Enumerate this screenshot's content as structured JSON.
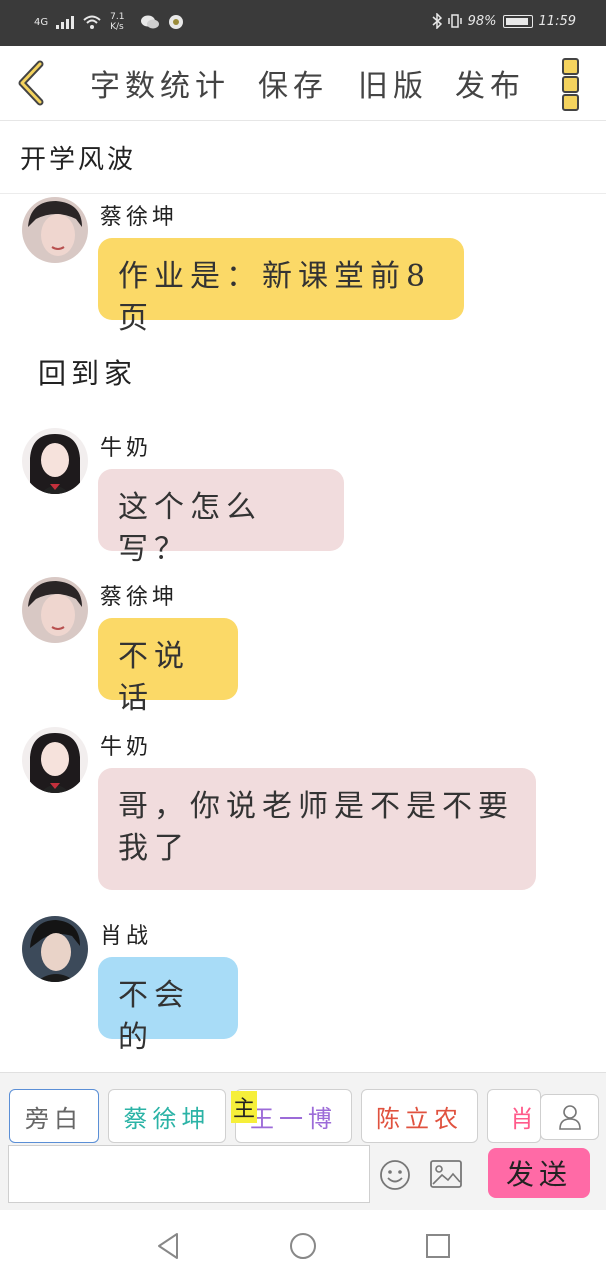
{
  "status_bar": {
    "network": "4G",
    "speed": "7.1 K/s",
    "battery": "98%",
    "time": "11:59"
  },
  "toolbar": {
    "word_count": "字数统计",
    "save": "保存",
    "old_version": "旧版",
    "publish": "发布"
  },
  "doc": {
    "title": "开学风波"
  },
  "messages": [
    {
      "name": "蔡徐坤",
      "text": "作业是：新课堂前8页"
    },
    {
      "narration": "回到家"
    },
    {
      "name": "牛奶",
      "text": "这个怎么写？"
    },
    {
      "name": "蔡徐坤",
      "text": "不说话"
    },
    {
      "name": "牛奶",
      "text_line1": "哥，你说老师是不是不要",
      "text_line2": "我了"
    },
    {
      "name": "肖战",
      "text": "不会的"
    }
  ],
  "characters": [
    {
      "label": "旁白",
      "color": "#666666"
    },
    {
      "label": "蔡徐坤",
      "color": "#2bb3a6"
    },
    {
      "label": "王一博",
      "color": "#9c6bd8",
      "badge": "主"
    },
    {
      "label": "陈立农",
      "color": "#e0523f"
    },
    {
      "label": "肖战",
      "color": "#ff5a8a"
    }
  ],
  "composer": {
    "send": "发送",
    "placeholder": ""
  }
}
